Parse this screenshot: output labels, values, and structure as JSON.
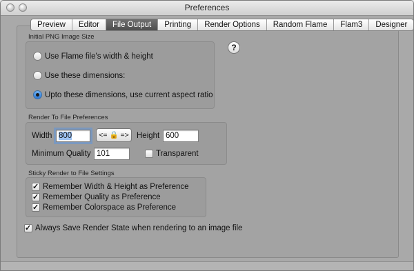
{
  "window": {
    "title": "Preferences"
  },
  "tabs": [
    {
      "label": "Preview"
    },
    {
      "label": "Editor"
    },
    {
      "label": "File Output",
      "active": true
    },
    {
      "label": "Printing"
    },
    {
      "label": "Render Options"
    },
    {
      "label": "Random Flame"
    },
    {
      "label": "Flam3"
    },
    {
      "label": "Designer"
    }
  ],
  "help": {
    "label": "?"
  },
  "initial_png": {
    "title": "Initial PNG Image Size",
    "options": [
      {
        "label": "Use Flame file's width & height",
        "selected": false
      },
      {
        "label": "Use these dimensions:",
        "selected": false
      },
      {
        "label": "Upto these dimensions, use current aspect ratio",
        "selected": true
      }
    ]
  },
  "render_to_file": {
    "title": "Render To File Preferences",
    "width_label": "Width",
    "width_value": "800",
    "lock_label": "<= 🔒 =>",
    "height_label": "Height",
    "height_value": "600",
    "min_quality_label": "Minimum Quality",
    "min_quality_value": "101",
    "transparent_label": "Transparent",
    "transparent_checked": false
  },
  "sticky": {
    "title": "Sticky Render to File Settings",
    "items": [
      {
        "label": "Remember Width & Height as Preference",
        "checked": true
      },
      {
        "label": "Remember Quality as Preference",
        "checked": true
      },
      {
        "label": "Remember Colorspace as Preference",
        "checked": true
      }
    ]
  },
  "always_save": {
    "label": "Always Save Render State when rendering to an image file",
    "checked": true
  }
}
